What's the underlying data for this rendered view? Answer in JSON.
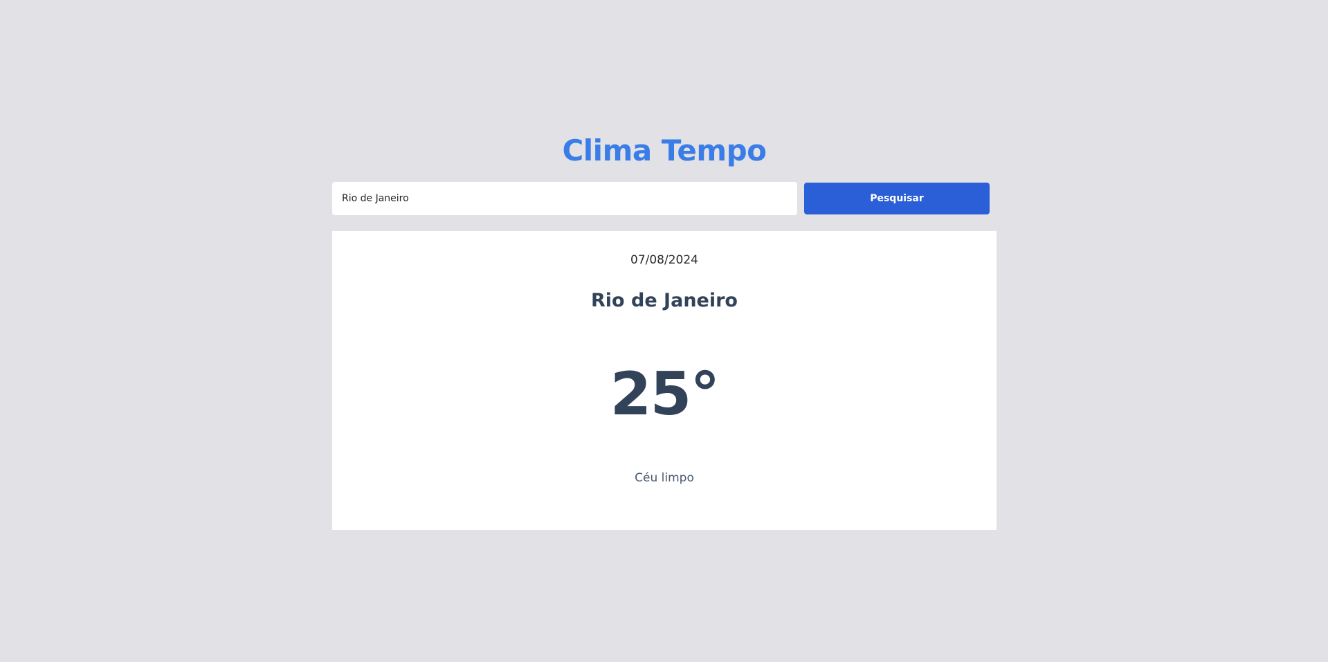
{
  "app": {
    "title": "Clima Tempo"
  },
  "search": {
    "value": "Rio de Janeiro",
    "button_label": "Pesquisar"
  },
  "weather": {
    "date": "07/08/2024",
    "city": "Rio de Janeiro",
    "temperature": "25°",
    "description": "Céu limpo"
  },
  "colors": {
    "background": "#e1e1e6",
    "title": "#3b7de6",
    "button": "#2a5fd8",
    "card": "#ffffff",
    "text_dark": "#324359"
  }
}
